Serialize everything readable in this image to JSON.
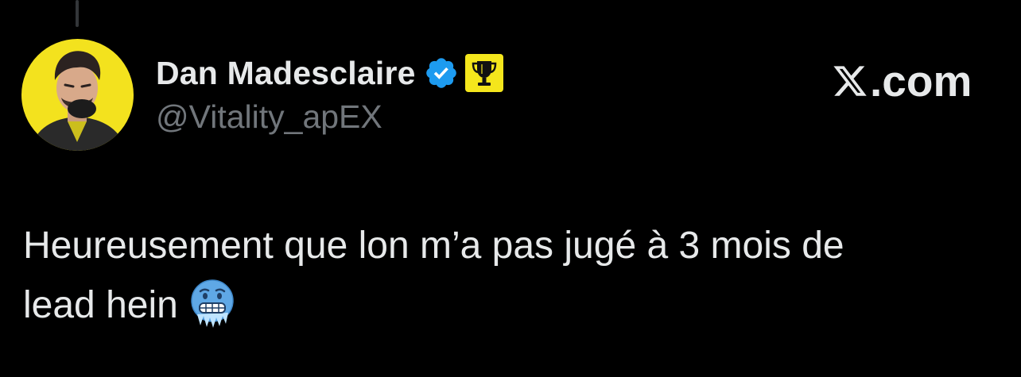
{
  "author": {
    "display_name": "Dan Madesclaire",
    "handle": "@Vitality_apEX",
    "verified_icon": "verified-badge-icon",
    "affiliate_icon": "trophy-badge-icon",
    "avatar_icon": "profile-avatar"
  },
  "watermark": {
    "text": ".com",
    "logo_icon": "x-logo-icon"
  },
  "tweet": {
    "line1": "Heureusement que lon m’a pas jugé à 3 mois de",
    "line2": "lead hein",
    "emoji_icon": "cold-face-emoji"
  },
  "colors": {
    "background": "#000000",
    "text": "#e7e9ea",
    "secondary_text": "#71767b",
    "verified_blue": "#1d9bf0",
    "badge_yellow": "#f4e61c"
  }
}
